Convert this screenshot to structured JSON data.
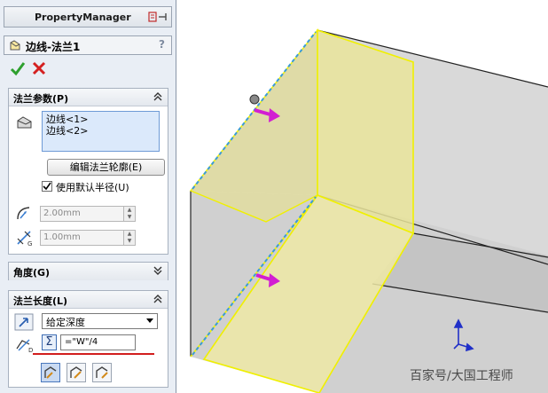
{
  "property_manager": {
    "title": "PropertyManager",
    "feature_name": "边线-法兰1",
    "help_glyph": "?",
    "ok_icon": "check-icon",
    "cancel_icon": "x-icon"
  },
  "flange_params": {
    "header": "法兰参数(P)",
    "edges": [
      "边线<1>",
      "边线<2>"
    ],
    "edit_profile_button": "编辑法兰轮廓(E)",
    "use_default_radius_label": "使用默认半径(U)",
    "use_default_radius_checked": true,
    "bend_radius": "2.00mm",
    "gap": "1.00mm"
  },
  "angle": {
    "header": "角度(G)"
  },
  "flange_length": {
    "header": "法兰长度(L)",
    "end_condition": "给定深度",
    "equation_value": "=\"W\"/4",
    "sigma_glyph": "Σ"
  },
  "colors": {
    "face_fill": "#d8d8d8",
    "flange_preview": "#f5f0a0",
    "selection_yellow": "#f0f000",
    "arrow_magenta": "#d21ed2",
    "triad_blue": "#2030c8",
    "red_underline": "#d21e1e"
  },
  "watermark": "百家号/大国工程师"
}
